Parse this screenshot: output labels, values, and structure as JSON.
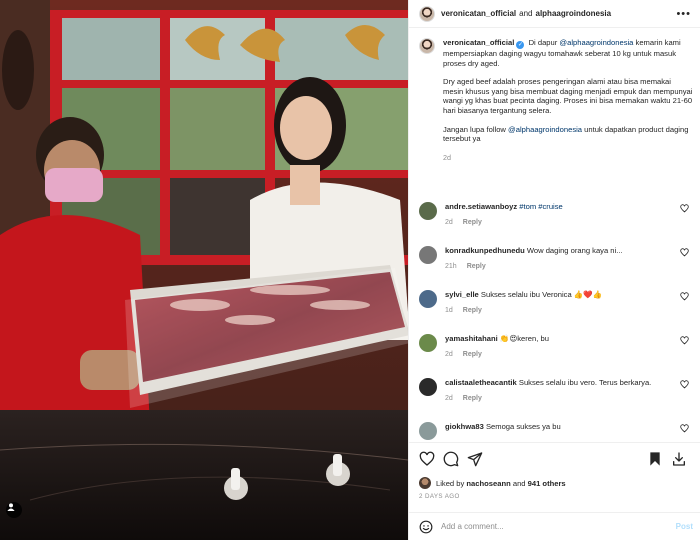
{
  "post": {
    "author": "veronicatan_official",
    "coauthor_joiner": "and",
    "coauthor": "alphaagroindonesia",
    "more_label": "•••"
  },
  "caption": {
    "author": "veronicatan_official",
    "p1_lead": "Di dapur",
    "p1_mention": "@alphaagroindonesia",
    "p1_rest": "kemarin kami mempersiapkan daging wagyu tomahawk seberat 10 kg untuk masuk proses dry aged.",
    "p2": "Dry aged beef adalah proses pengeringan alami atau bisa memakai mesin khusus yang bisa membuat daging menjadi empuk dan mempunyai wangi yg khas buat pecinta daging. Proses ini bisa memakan waktu 21-60 hari biasanya tergantung selera.",
    "p3_lead": "Jangan lupa follow",
    "p3_mention": "@alphaagroindonesia",
    "p3_rest": "untuk dapatkan product daging tersebut ya",
    "time": "2d"
  },
  "comments": [
    {
      "user": "andre.setiawanboyz",
      "text": "#tom #cruise",
      "time": "2d",
      "reply": "Reply",
      "color": "#5a6b4a"
    },
    {
      "user": "konradkunpedhunedu",
      "text": "Wow daging orang kaya ni...",
      "time": "21h",
      "reply": "Reply",
      "color": "#777777"
    },
    {
      "user": "sylvi_elle",
      "text": "Sukses selalu ibu Veronica 👍❤️👍",
      "time": "1d",
      "reply": "Reply",
      "color": "#4d6a8a"
    },
    {
      "user": "yamashitahani",
      "text": "👏😍keren, bu",
      "time": "2d",
      "reply": "Reply",
      "color": "#6b8a4a"
    },
    {
      "user": "calistaaletheacantik",
      "text": "Sukses selalu ibu vero. Terus berkarya.",
      "time": "2d",
      "reply": "Reply",
      "color": "#2a2a2a"
    },
    {
      "user": "giokhwa83",
      "text": "Semoga sukses ya bu",
      "time": "",
      "reply": "",
      "color": "#8a9a9a"
    }
  ],
  "likes": {
    "prefix": "Liked by",
    "user": "nachoseann",
    "joiner": "and",
    "others": "941 others"
  },
  "date": "2 DAYS AGO",
  "add_comment": {
    "placeholder": "Add a comment...",
    "post_label": "Post"
  },
  "icons": [
    "heart-icon",
    "comment-icon",
    "share-icon",
    "bookmark-icon",
    "download-icon",
    "emoji-icon",
    "user-tag-icon",
    "verified-icon"
  ],
  "colors": {
    "link": "#00376b",
    "muted": "#8e8e8e",
    "post_disabled": "#b2dffc",
    "verified": "#3897f0"
  }
}
